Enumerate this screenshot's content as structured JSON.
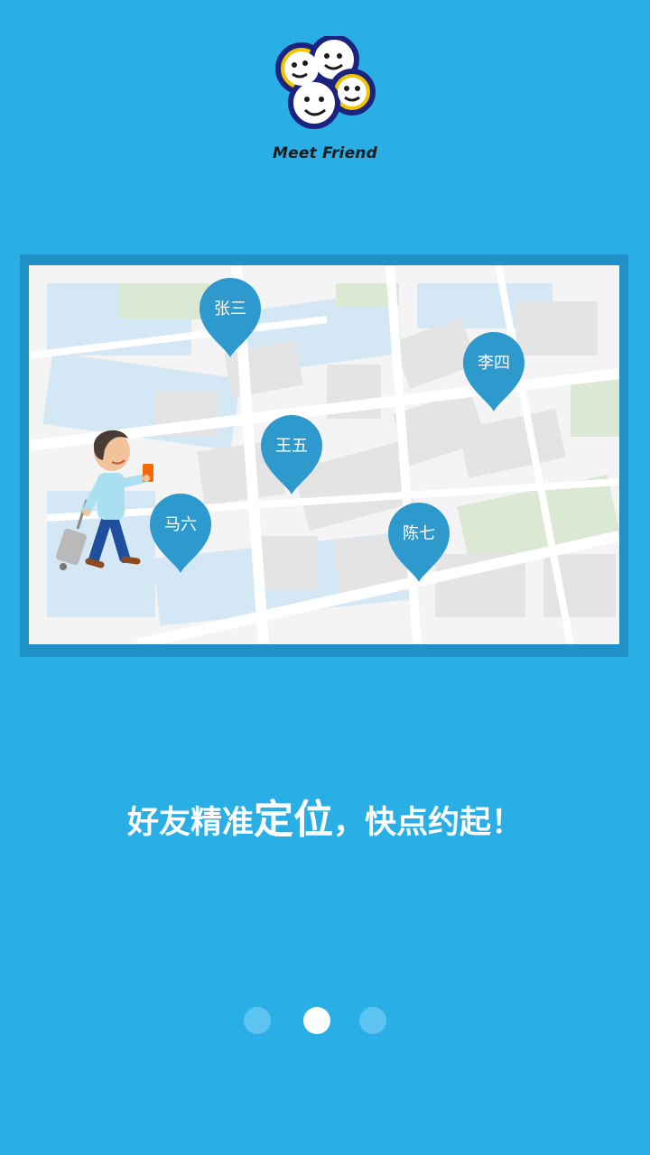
{
  "brand": {
    "name": "Meet Friend"
  },
  "map": {
    "pins": [
      "张三",
      "李四",
      "王五",
      "马六",
      "陈七"
    ]
  },
  "slogan": {
    "part1": "好友精准",
    "part2": "定位",
    "part3": "，快点约起！"
  },
  "pagination": {
    "total": 3,
    "active_index": 1
  },
  "colors": {
    "background": "#29afe6",
    "pin": "#2d99cc",
    "dot_inactive": "#5cc4ee",
    "dot_active": "#ffffff"
  }
}
